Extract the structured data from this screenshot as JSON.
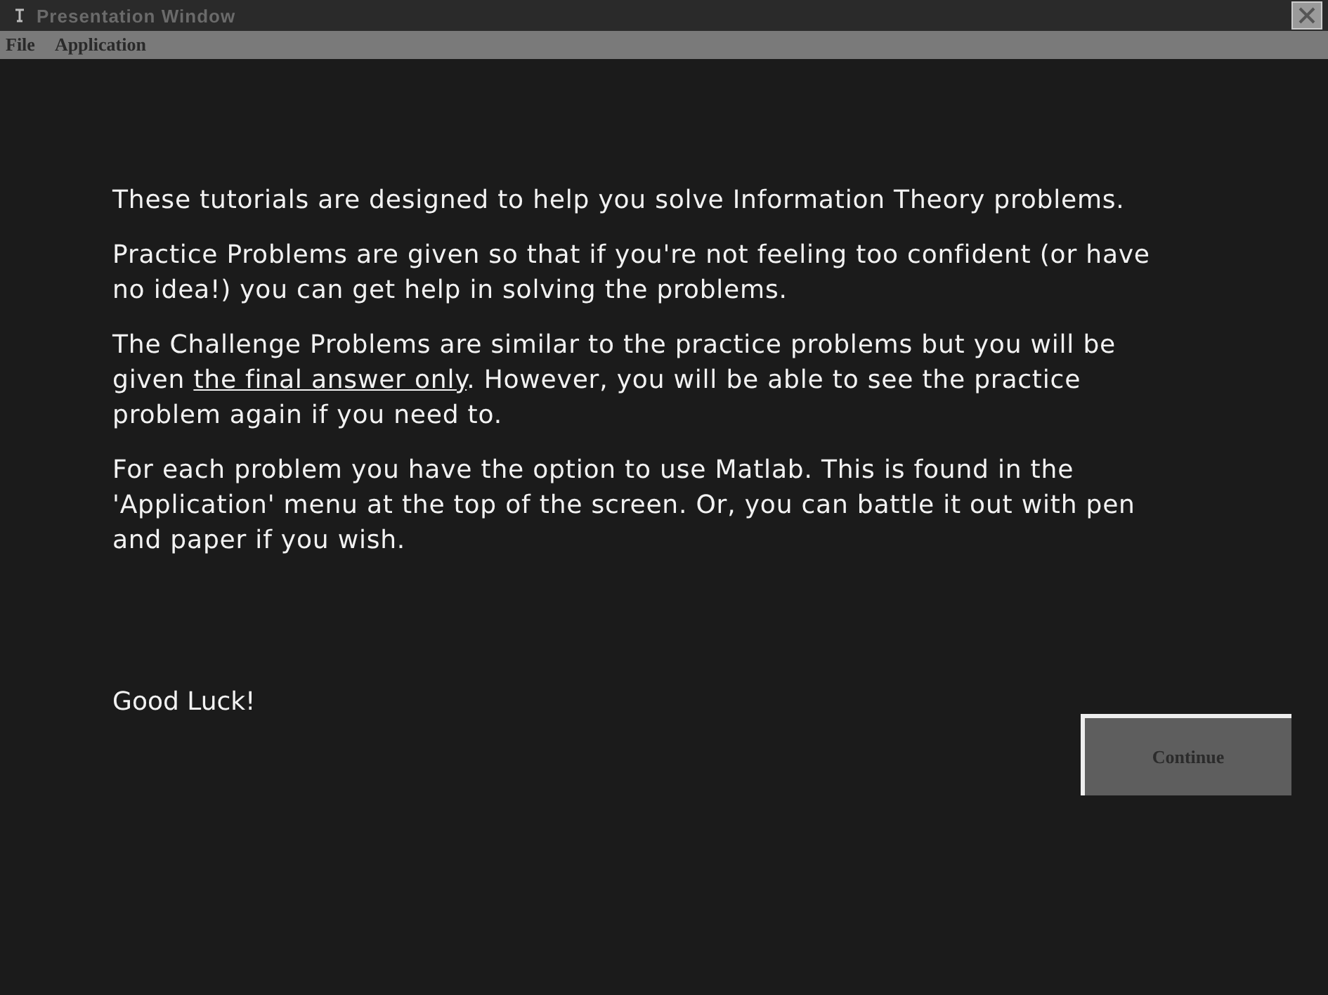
{
  "window": {
    "title": "Presentation Window"
  },
  "menu": [
    {
      "label": "File"
    },
    {
      "label": "Application"
    }
  ],
  "paragraphs": [
    {
      "segments": [
        {
          "text": "These tutorials are designed to help you solve Information Theory problems.",
          "underline": false
        }
      ]
    },
    {
      "segments": [
        {
          "text": "Practice Problems are given so that if you're not feeling too confident (or have no idea!) you can get help in solving the problems.",
          "underline": false
        }
      ]
    },
    {
      "segments": [
        {
          "text": "The Challenge Problems are similar to the practice problems but you will be given ",
          "underline": false
        },
        {
          "text": "the final answer only",
          "underline": true
        },
        {
          "text": ".  However, you will be able to see the practice problem again if you need to.",
          "underline": false
        }
      ]
    },
    {
      "segments": [
        {
          "text": "For each problem you have the option to use Matlab.  This is found in the 'Application' menu at the top of the screen.  Or, you can battle it out with pen and paper if you wish.",
          "underline": false
        }
      ]
    }
  ],
  "closing": "Good Luck!",
  "button": {
    "label": "Continue"
  }
}
